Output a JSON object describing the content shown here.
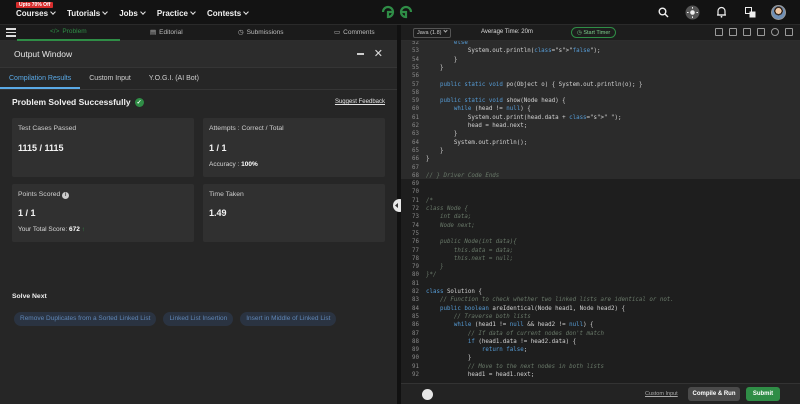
{
  "nav": {
    "promo": "Upto 70% Off",
    "items": [
      "Courses",
      "Tutorials",
      "Jobs",
      "Practice",
      "Contests"
    ]
  },
  "problem_tabs": [
    "Problem",
    "Editorial",
    "Submissions",
    "Comments"
  ],
  "output": {
    "title": "Output Window",
    "tabs": [
      "Compilation Results",
      "Custom Input",
      "Y.O.G.I. (AI Bot)"
    ],
    "status": "Problem Solved Successfully",
    "suggest_feedback": "Suggest Feedback",
    "cards": {
      "test_cases_label": "Test Cases Passed",
      "test_cases_value": "1115 / 1115",
      "attempts_label": "Attempts : Correct / Total",
      "attempts_value": "1 / 1",
      "accuracy_label": "Accuracy :",
      "accuracy_value": "100%",
      "points_label": "Points Scored",
      "points_value": "1 / 1",
      "total_score_label": "Your Total Score:",
      "total_score_value": "672",
      "time_label": "Time Taken",
      "time_value": "1.49"
    },
    "solve_next_label": "Solve Next",
    "solve_next": [
      "Remove Duplicates from a Sorted Linked List",
      "Linked List Insertion",
      "Insert in Middle of Linked List"
    ]
  },
  "editor": {
    "language": "Java (1.8)",
    "average_time": "Average Time: 20m",
    "start_timer": "Start Timer",
    "custom_input": "Custom Input",
    "compile_run": "Compile & Run",
    "submit": "Submit",
    "lines": [
      {
        "n": "52",
        "code": "        else"
      },
      {
        "n": "53",
        "code": "            System.out.println(\"false\");"
      },
      {
        "n": "54",
        "code": "        }"
      },
      {
        "n": "55",
        "code": "    }"
      },
      {
        "n": "56",
        "code": ""
      },
      {
        "n": "57",
        "code": "    public static void po(Object o) { System.out.println(o); }"
      },
      {
        "n": "58",
        "code": ""
      },
      {
        "n": "59",
        "code": "    public static void show(Node head) {"
      },
      {
        "n": "60",
        "code": "        while (head != null) {"
      },
      {
        "n": "61",
        "code": "            System.out.print(head.data + \" \");"
      },
      {
        "n": "62",
        "code": "            head = head.next;"
      },
      {
        "n": "63",
        "code": "        }"
      },
      {
        "n": "64",
        "code": "        System.out.println();"
      },
      {
        "n": "65",
        "code": "    }"
      },
      {
        "n": "66",
        "code": "}"
      },
      {
        "n": "67",
        "code": ""
      },
      {
        "n": "68",
        "code": "// } Driver Code Ends"
      },
      {
        "n": "69",
        "code": ""
      },
      {
        "n": "70",
        "code": ""
      },
      {
        "n": "71",
        "code": "/*"
      },
      {
        "n": "72",
        "code": "class Node {"
      },
      {
        "n": "73",
        "code": "    int data;"
      },
      {
        "n": "74",
        "code": "    Node next;"
      },
      {
        "n": "75",
        "code": ""
      },
      {
        "n": "76",
        "code": "    public Node(int data){"
      },
      {
        "n": "77",
        "code": "        this.data = data;"
      },
      {
        "n": "78",
        "code": "        this.next = null;"
      },
      {
        "n": "79",
        "code": "    }"
      },
      {
        "n": "80",
        "code": "}*/"
      },
      {
        "n": "81",
        "code": ""
      },
      {
        "n": "82",
        "code": "class Solution {"
      },
      {
        "n": "83",
        "code": "    // Function to check whether two linked lists are identical or not."
      },
      {
        "n": "84",
        "code": "    public boolean areIdentical(Node head1, Node head2) {"
      },
      {
        "n": "85",
        "code": "        // Traverse both lists"
      },
      {
        "n": "86",
        "code": "        while (head1 != null && head2 != null) {"
      },
      {
        "n": "87",
        "code": "            // If data of current nodes don't match"
      },
      {
        "n": "88",
        "code": "            if (head1.data != head2.data) {"
      },
      {
        "n": "89",
        "code": "                return false;"
      },
      {
        "n": "90",
        "code": "            }"
      },
      {
        "n": "91",
        "code": "            // Move to the next nodes in both lists"
      },
      {
        "n": "92",
        "code": "            head1 = head1.next;"
      }
    ]
  },
  "colors": {
    "accent": "#2f8d46",
    "link": "#5aa9e6"
  }
}
